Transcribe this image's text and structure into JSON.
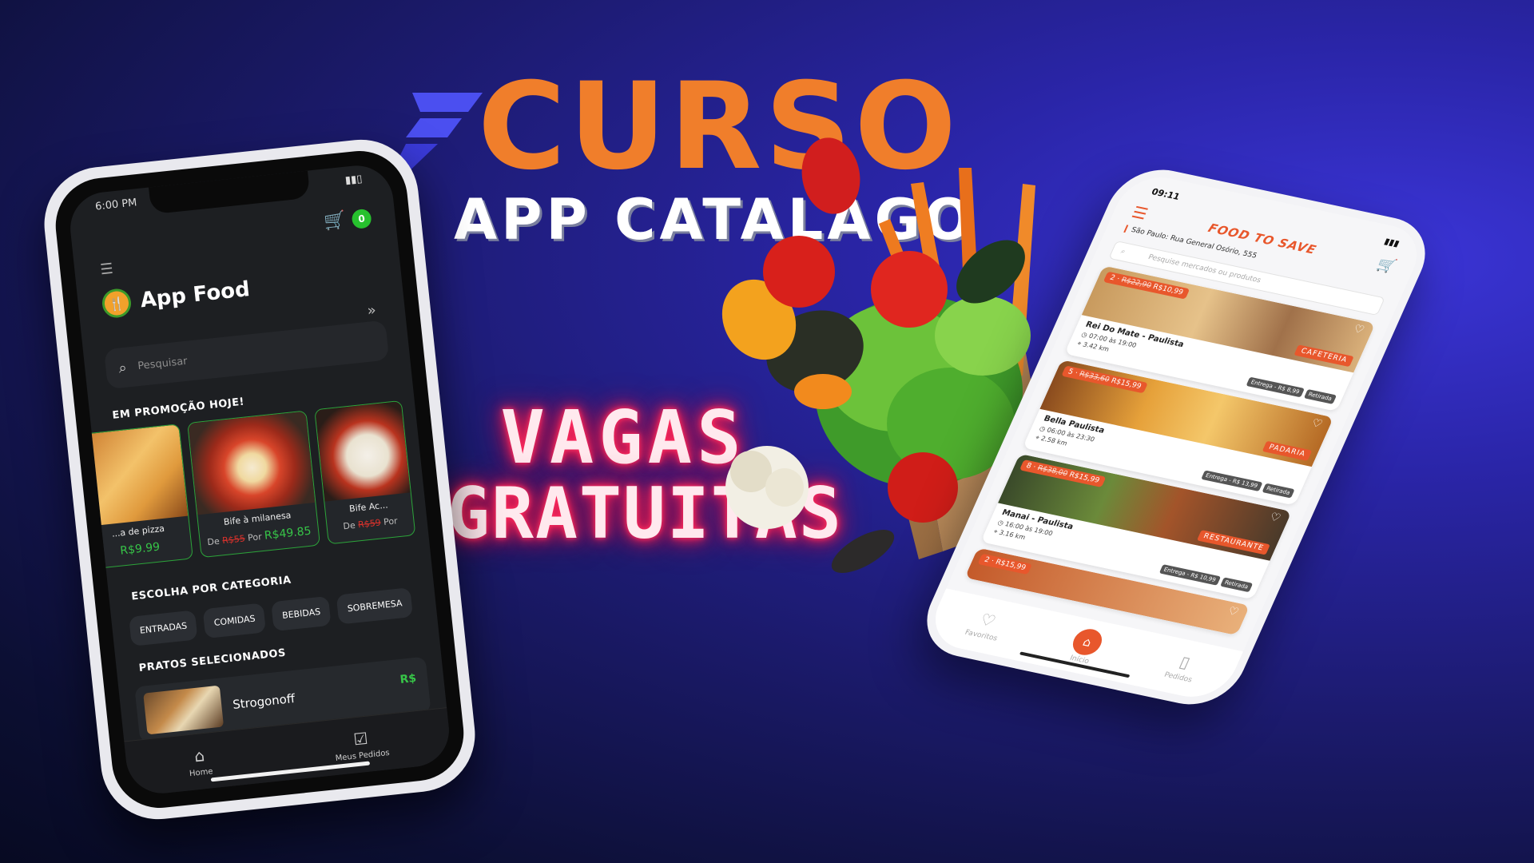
{
  "headline": {
    "title": "CURSO",
    "subtitle": "APP CATALAGO",
    "promo_line1": "VAGAS",
    "promo_line2": "GRATUITAS"
  },
  "colors": {
    "title_orange": "#f07e2b",
    "logo_blue": "#4b4ff0",
    "neon_pink": "#ff2a5c",
    "app_green": "#27c12e",
    "foodsave_orange": "#e8572c"
  },
  "left_app": {
    "status_time": "6:00 PM",
    "cart_count": "0",
    "menu_icon": "menu-icon",
    "brand_name": "App Food",
    "search_placeholder": "Pesquisar",
    "promo_heading": "EM PROMOÇÃO HOJE!",
    "promo_items": [
      {
        "name": "...a de pizza",
        "price_new": "R$9.99"
      },
      {
        "name": "Bife à milanesa",
        "from_label": "De",
        "price_old": "R$55",
        "by_label": "Por",
        "price_new": "R$49.85"
      },
      {
        "name": "Bife Ac...",
        "from_label": "De",
        "price_old": "R$59",
        "by_label": "Por"
      }
    ],
    "category_heading": "ESCOLHA POR CATEGORIA",
    "categories": [
      "ENTRADAS",
      "COMIDAS",
      "BEBIDAS",
      "SOBREMESA"
    ],
    "selected_heading": "PRATOS SELECIONADOS",
    "selected_item": {
      "name": "Strogonoff",
      "price": "R$"
    },
    "tabs": [
      {
        "label": "Home",
        "icon": "home-icon"
      },
      {
        "label": "Meus Pedidos",
        "icon": "orders-list-icon"
      }
    ]
  },
  "right_app": {
    "status_time": "09:11",
    "brand": "FOOD TO SAVE",
    "address": "São Paulo: Rua General Osório, 555",
    "search_placeholder": "Pesquise mercados ou produtos",
    "stores": [
      {
        "qty": "2",
        "price_old": "R$22,90",
        "price_new": "R$10,99",
        "category": "CAFETERIA",
        "name": "Rei Do Mate - Paulista",
        "hours": "07:00 às 19:00",
        "distance": "3.42 km",
        "delivery": "Entrega - R$ 8,99",
        "pickup": "Retirada"
      },
      {
        "qty": "5",
        "price_old": "R$33,60",
        "price_new": "R$15,99",
        "category": "PADARIA",
        "name": "Bella Paulista",
        "hours": "06:00 às 23:30",
        "distance": "2.58 km",
        "delivery": "Entrega - R$ 13,99",
        "pickup": "Retirada"
      },
      {
        "qty": "8",
        "price_old": "R$38,00",
        "price_new": "R$15,99",
        "category": "RESTAURANTE",
        "name": "Manai - Paulista",
        "hours": "16:00 às 19:00",
        "distance": "3.16 km",
        "delivery": "Entrega - R$ 10,99",
        "pickup": "Retirada"
      },
      {
        "qty": "2",
        "price_new": "R$15,99"
      }
    ],
    "tabs": [
      {
        "label": "Favoritos",
        "icon": "heart-icon"
      },
      {
        "label": "Início",
        "icon": "home-icon"
      },
      {
        "label": "Pedidos",
        "icon": "bag-icon"
      }
    ]
  }
}
